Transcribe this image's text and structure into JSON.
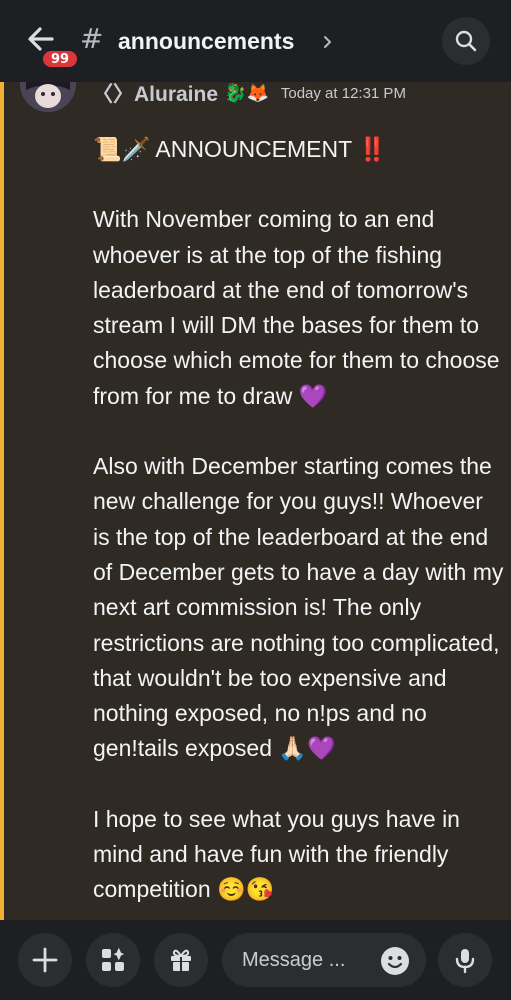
{
  "header": {
    "unread_badge": "99",
    "channel_hash": "#",
    "channel_name": "announcements",
    "icons": {
      "back": "arrow-left-icon",
      "chevron": "chevron-right-icon",
      "search": "search-icon"
    }
  },
  "message": {
    "author": "〈〉Aluraine",
    "author_icons": "🐉🦊",
    "timestamp": "Today at 12:31 PM",
    "paragraphs": [
      "📜🗡️ ANNOUNCEMENT ‼️",
      "With November coming to an end whoever is at the top of the fishing leaderboard at the end of tomorrow's stream I will DM the bases for them to choose which emote for them to choose from for me to draw 💜",
      "Also with December starting comes the new challenge for you guys!! Whoever is the top of the leaderboard at the end of December gets to have a day with my next art commission is! The only restrictions are nothing too complicated, that wouldn't be too expensive and nothing exposed, no n!ps and no gen!tails exposed 🙏🏻💜",
      "I hope to see what you guys have in mind and have fun with the friendly competition ☺️😘"
    ]
  },
  "composer": {
    "placeholder": "Message ...",
    "icons": {
      "add": "plus-icon",
      "apps": "apps-icon",
      "gift": "gift-icon",
      "emoji": "emoji-icon",
      "mic": "microphone-icon"
    }
  },
  "colors": {
    "mention_bar": "#f0b132",
    "badge": "#da373c",
    "message_bg": "#2f2b24"
  }
}
